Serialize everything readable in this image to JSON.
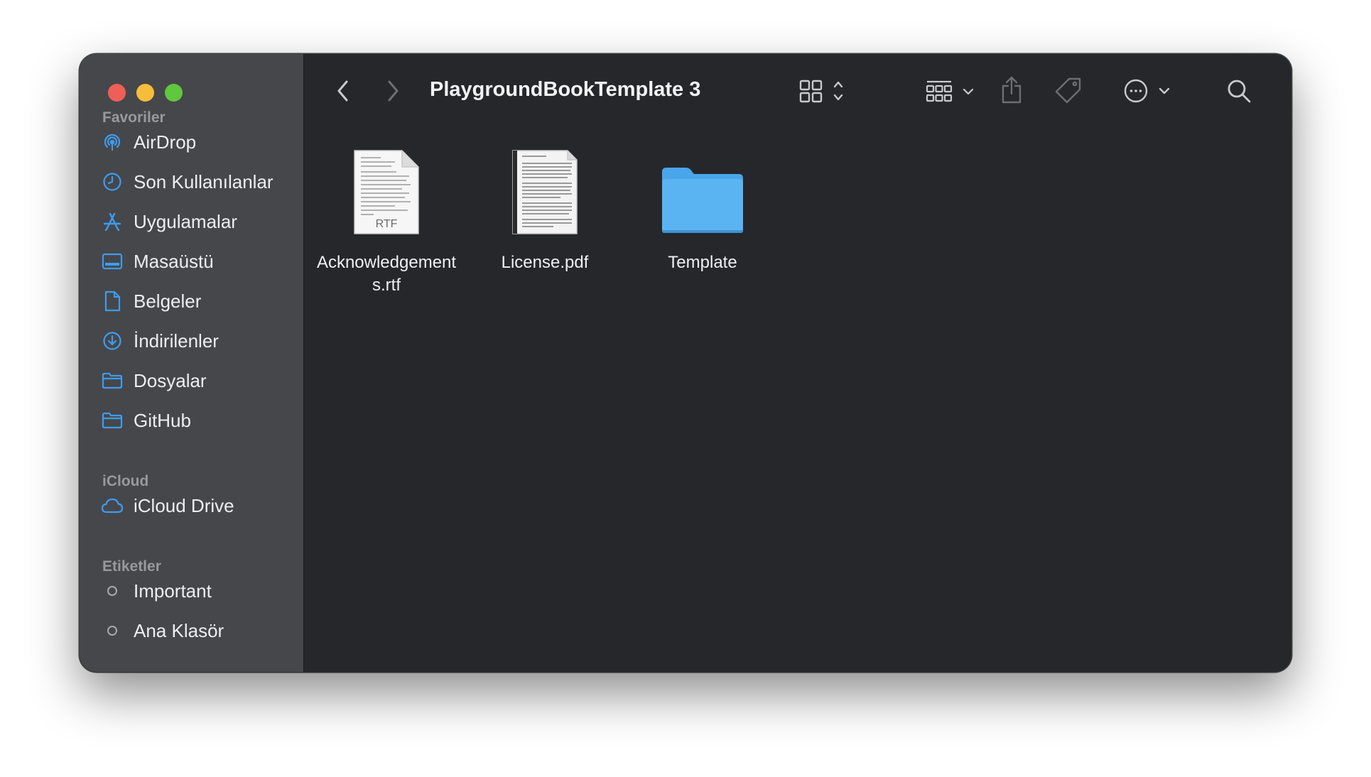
{
  "window": {
    "title": "PlaygroundBookTemplate 3"
  },
  "sidebar": {
    "sections": [
      {
        "title": "Favoriler",
        "items": [
          {
            "label": "AirDrop",
            "icon": "airdrop-icon"
          },
          {
            "label": "Son Kullanılanlar",
            "icon": "clock-icon"
          },
          {
            "label": "Uygulamalar",
            "icon": "applications-icon"
          },
          {
            "label": "Masaüstü",
            "icon": "desktop-icon"
          },
          {
            "label": "Belgeler",
            "icon": "document-icon"
          },
          {
            "label": "İndirilenler",
            "icon": "download-icon"
          },
          {
            "label": "Dosyalar",
            "icon": "folder-icon"
          },
          {
            "label": "GitHub",
            "icon": "folder-icon"
          }
        ]
      },
      {
        "title": "iCloud",
        "items": [
          {
            "label": "iCloud Drive",
            "icon": "cloud-icon"
          }
        ]
      },
      {
        "title": "Etiketler",
        "items": [
          {
            "label": "Important",
            "icon": "tag-circle-icon"
          },
          {
            "label": "Ana Klasör",
            "icon": "tag-circle-icon"
          }
        ]
      }
    ]
  },
  "files": [
    {
      "name": "Acknowledgements.rtf",
      "kind": "rtf-document-icon",
      "badge": "RTF"
    },
    {
      "name": "License.pdf",
      "kind": "pdf-document-icon"
    },
    {
      "name": "Template",
      "kind": "folder-icon"
    }
  ],
  "colors": {
    "accent": "#3d9cf0",
    "close": "#ee5f57",
    "minimize": "#f6bd3b",
    "zoom": "#5fc83e",
    "folder": "#5ab4f2"
  }
}
